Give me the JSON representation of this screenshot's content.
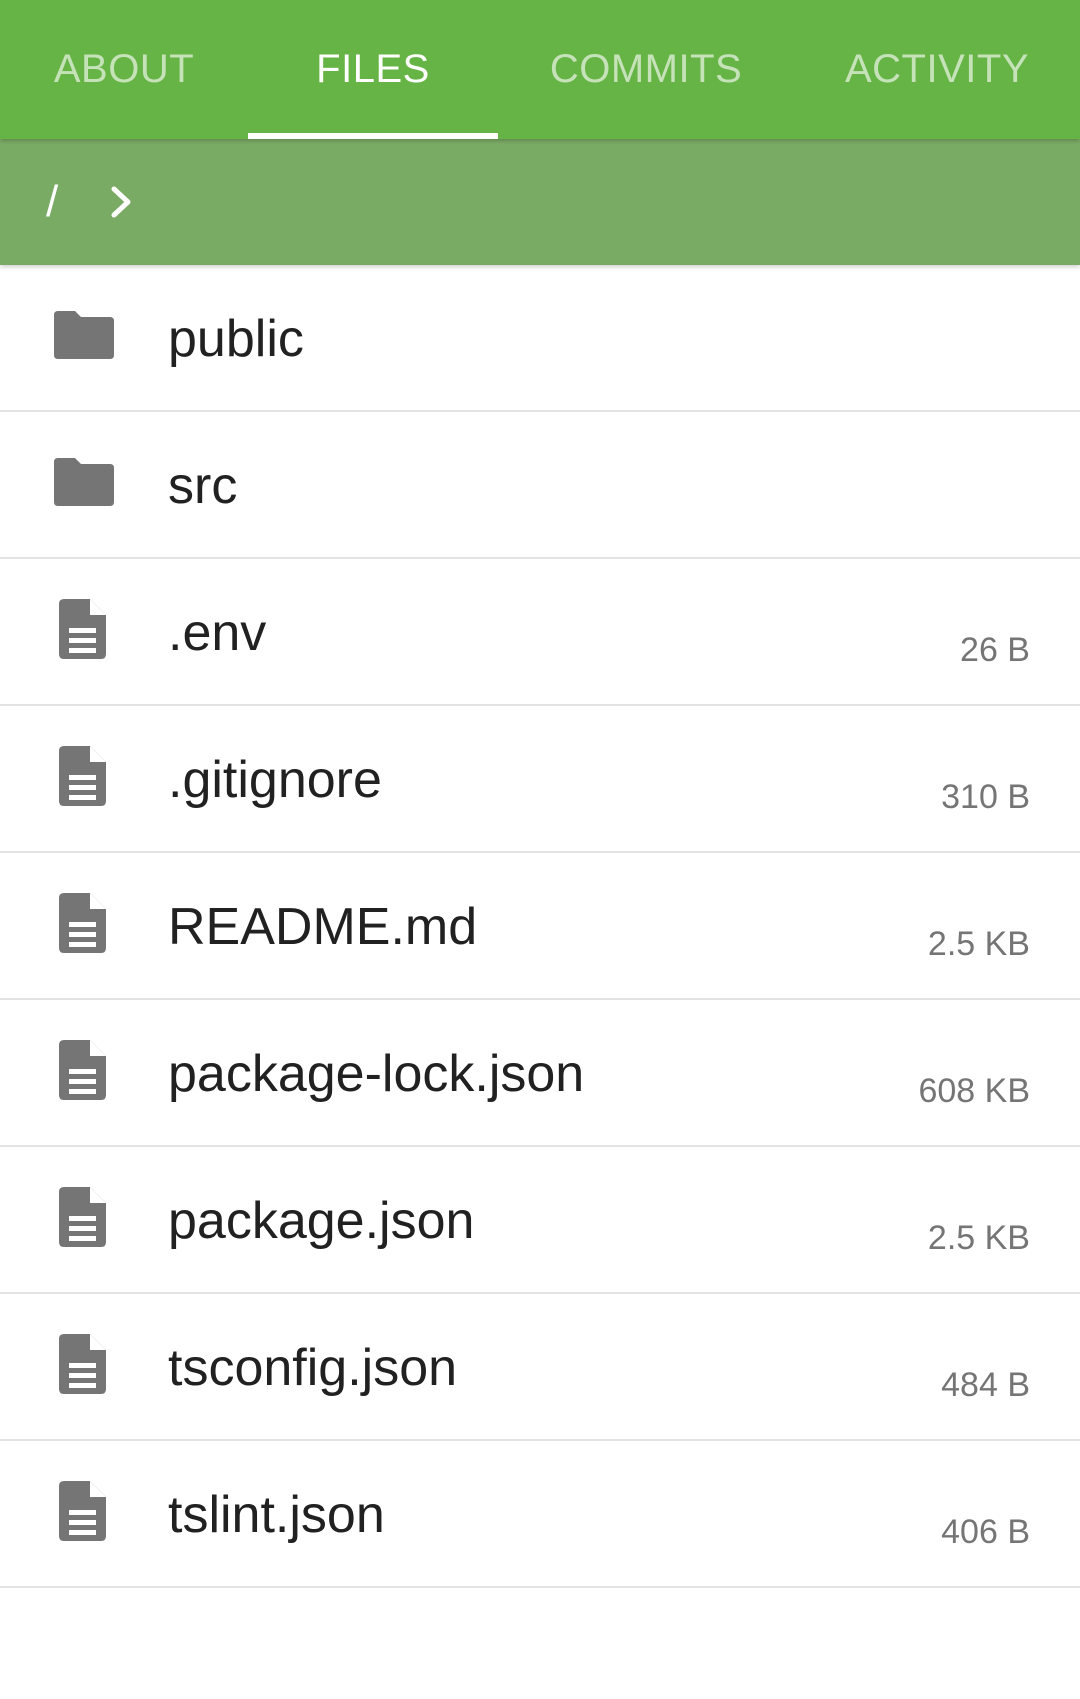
{
  "tabs": [
    {
      "label": "ABOUT",
      "active": false
    },
    {
      "label": "FILES",
      "active": true
    },
    {
      "label": "COMMITS",
      "active": false
    },
    {
      "label": "ACTIVITY",
      "active": false
    }
  ],
  "breadcrumb": {
    "root": "/"
  },
  "colors": {
    "tab_bar": "#66b445",
    "breadcrumb_bar": "#7aab64",
    "icon": "#757575"
  },
  "files": [
    {
      "name": "public",
      "type": "folder",
      "icon": "folder-icon",
      "size": ""
    },
    {
      "name": "src",
      "type": "folder",
      "icon": "folder-icon",
      "size": ""
    },
    {
      "name": ".env",
      "type": "file",
      "icon": "file-icon",
      "size": "26 B"
    },
    {
      "name": ".gitignore",
      "type": "file",
      "icon": "file-icon",
      "size": "310 B"
    },
    {
      "name": "README.md",
      "type": "file",
      "icon": "file-icon",
      "size": "2.5 KB"
    },
    {
      "name": "package-lock.json",
      "type": "file",
      "icon": "file-icon",
      "size": "608 KB"
    },
    {
      "name": "package.json",
      "type": "file",
      "icon": "file-icon",
      "size": "2.5 KB"
    },
    {
      "name": "tsconfig.json",
      "type": "file",
      "icon": "file-icon",
      "size": "484 B"
    },
    {
      "name": "tslint.json",
      "type": "file",
      "icon": "file-icon",
      "size": "406 B"
    }
  ]
}
